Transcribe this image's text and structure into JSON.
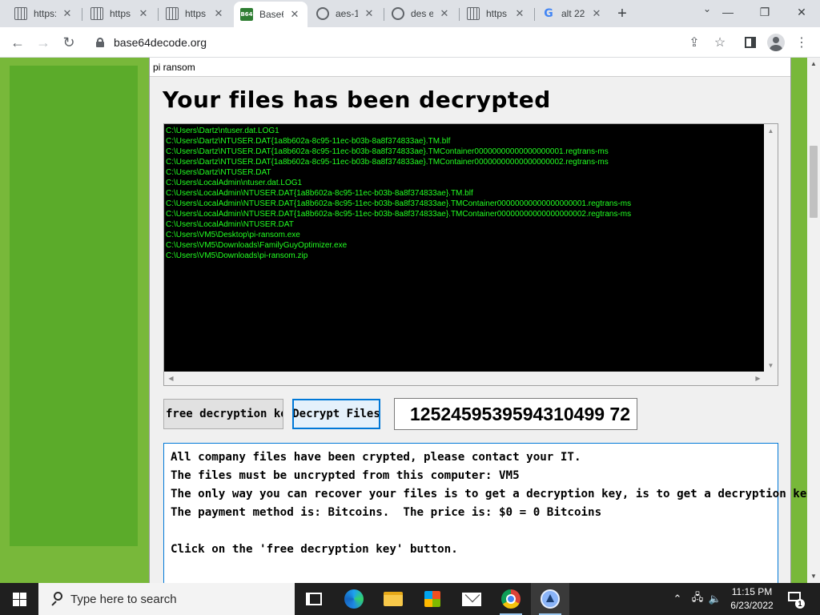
{
  "browser": {
    "tabs": [
      {
        "title": "https:",
        "favicon": "grid-favicon",
        "active": false
      },
      {
        "title": "https",
        "favicon": "grid-favicon",
        "active": false
      },
      {
        "title": "https",
        "favicon": "grid-favicon",
        "active": false
      },
      {
        "title": "Base6",
        "favicon": "base64-favicon",
        "active": true
      },
      {
        "title": "aes-1",
        "favicon": "globe-favicon",
        "active": false
      },
      {
        "title": "des e",
        "favicon": "globe-favicon",
        "active": false
      },
      {
        "title": "https",
        "favicon": "grid-favicon",
        "active": false
      },
      {
        "title": "alt 22",
        "favicon": "google-favicon",
        "active": false
      }
    ],
    "new_tab_symbol": "+",
    "url": "base64decode.org",
    "window_controls": {
      "minimize": "—",
      "restore": "❐",
      "close": "✕"
    }
  },
  "app_window": {
    "title": "pi ransom",
    "heading": "Your files has been decrypted",
    "console_lines": [
      "C:\\Users\\Dartz\\ntuser.dat.LOG1",
      "C:\\Users\\Dartz\\NTUSER.DAT{1a8b602a-8c95-11ec-b03b-8a8f374833ae}.TM.blf",
      "C:\\Users\\Dartz\\NTUSER.DAT{1a8b602a-8c95-11ec-b03b-8a8f374833ae}.TMContainer00000000000000000001.regtrans-ms",
      "C:\\Users\\Dartz\\NTUSER.DAT{1a8b602a-8c95-11ec-b03b-8a8f374833ae}.TMContainer00000000000000000002.regtrans-ms",
      "C:\\Users\\Dartz\\NTUSER.DAT",
      "C:\\Users\\LocalAdmin\\ntuser.dat.LOG1",
      "C:\\Users\\LocalAdmin\\NTUSER.DAT{1a8b602a-8c95-11ec-b03b-8a8f374833ae}.TM.blf",
      "C:\\Users\\LocalAdmin\\NTUSER.DAT{1a8b602a-8c95-11ec-b03b-8a8f374833ae}.TMContainer00000000000000000001.regtrans-ms",
      "C:\\Users\\LocalAdmin\\NTUSER.DAT{1a8b602a-8c95-11ec-b03b-8a8f374833ae}.TMContainer00000000000000000002.regtrans-ms",
      "C:\\Users\\LocalAdmin\\NTUSER.DAT",
      "C:\\Users\\VM5\\Desktop\\pi-ransom.exe",
      "C:\\Users\\VM5\\Downloads\\FamilyGuyOptimizer.exe",
      "C:\\Users\\VM5\\Downloads\\pi-ransom.zip"
    ],
    "free_key_button": "free decryption key",
    "decrypt_button": "Decrypt Files",
    "key_value": "1252459539594310499 72",
    "message_lines": [
      "All company files have been crypted, please contact your IT.",
      "The files must be uncrypted from this computer: VM5",
      "The only way you can recover your files is to get a decryption key, is to get a decryption key.",
      "The payment method is: Bitcoins.  The price is: $0 = 0 Bitcoins",
      "",
      "Click on the 'free decryption key' button."
    ]
  },
  "taskbar": {
    "search_placeholder": "Type here to search",
    "time": "11:15 PM",
    "date": "6/23/2022",
    "notification_count": "1"
  },
  "colors": {
    "console_text": "#22ff22",
    "page_green": "#78b83a",
    "focus_blue": "#0078d7"
  }
}
